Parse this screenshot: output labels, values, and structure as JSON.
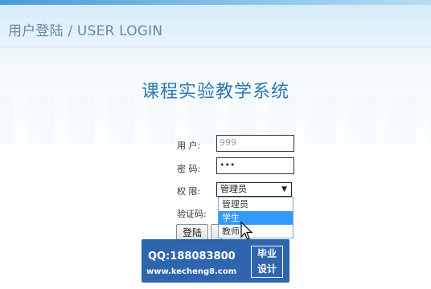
{
  "header": {
    "title": "用户登陆 / USER LOGIN"
  },
  "app_title": "课程实验教学系统",
  "form": {
    "username_label": "用 户:",
    "username_value": "999",
    "password_label": "密 码:",
    "password_value": "•••",
    "role_label": "权 限:",
    "role_selected": "管理员",
    "role_options": [
      "管理员",
      "学生",
      "教师"
    ],
    "captcha_label": "验证码:",
    "login_button": "登陆",
    "second_button": ""
  },
  "watermark": {
    "qq": "QQ:188083800",
    "site": "www.kecheng8.com",
    "badge_line1": "毕业",
    "badge_line2": "设计"
  },
  "icons": {
    "dropdown_arrow": "chevron-down-icon",
    "cursor": "mouse-pointer-icon"
  }
}
